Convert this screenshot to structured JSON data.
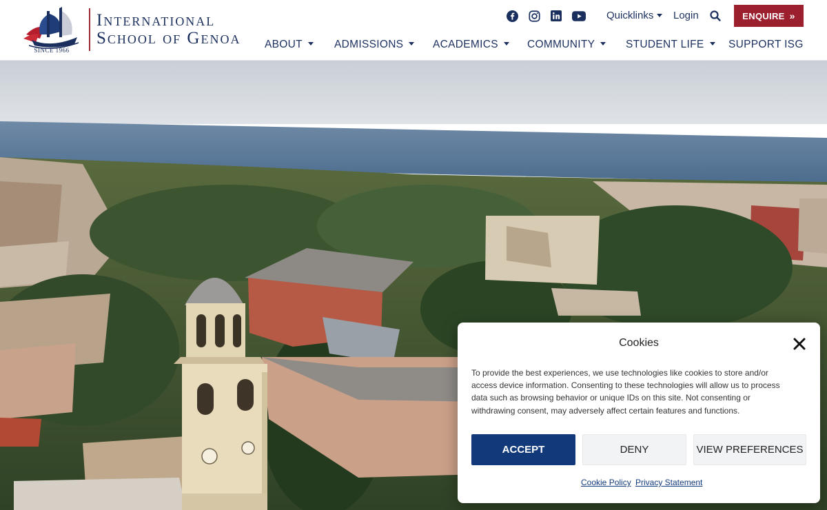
{
  "header": {
    "logo": {
      "line1": "International",
      "line2": "School of Genoa",
      "since": "SINCE 1966"
    },
    "social": [
      {
        "icon": "facebook-icon"
      },
      {
        "icon": "instagram-icon"
      },
      {
        "icon": "linkedin-icon"
      },
      {
        "icon": "youtube-icon"
      }
    ],
    "quicklinks_label": "Quicklinks",
    "login_label": "Login",
    "search_icon": "search-icon",
    "enquire_label": "ENQUIRE",
    "nav": [
      {
        "label": "ABOUT",
        "has_dropdown": true
      },
      {
        "label": "ADMISSIONS",
        "has_dropdown": true
      },
      {
        "label": "ACADEMICS",
        "has_dropdown": true
      },
      {
        "label": "COMMUNITY",
        "has_dropdown": true
      },
      {
        "label": "STUDENT LIFE",
        "has_dropdown": true
      },
      {
        "label": "SUPPORT ISG",
        "has_dropdown": false
      }
    ]
  },
  "colors": {
    "brand_navy": "#1b2f5f",
    "brand_red": "#9c1f2e",
    "accept_blue": "#123a7a"
  },
  "cookie_banner": {
    "title": "Cookies",
    "text": "To provide the best experiences, we use technologies like cookies to store and/or access device information. Consenting to these technologies will allow us to process data such as browsing behavior or unique IDs on this site. Not consenting or withdrawing consent, may adversely affect certain features and functions.",
    "accept_label": "ACCEPT",
    "deny_label": "DENY",
    "preferences_label": "VIEW PREFERENCES",
    "cookie_policy_label": "Cookie Policy",
    "privacy_statement_label": "Privacy Statement"
  }
}
